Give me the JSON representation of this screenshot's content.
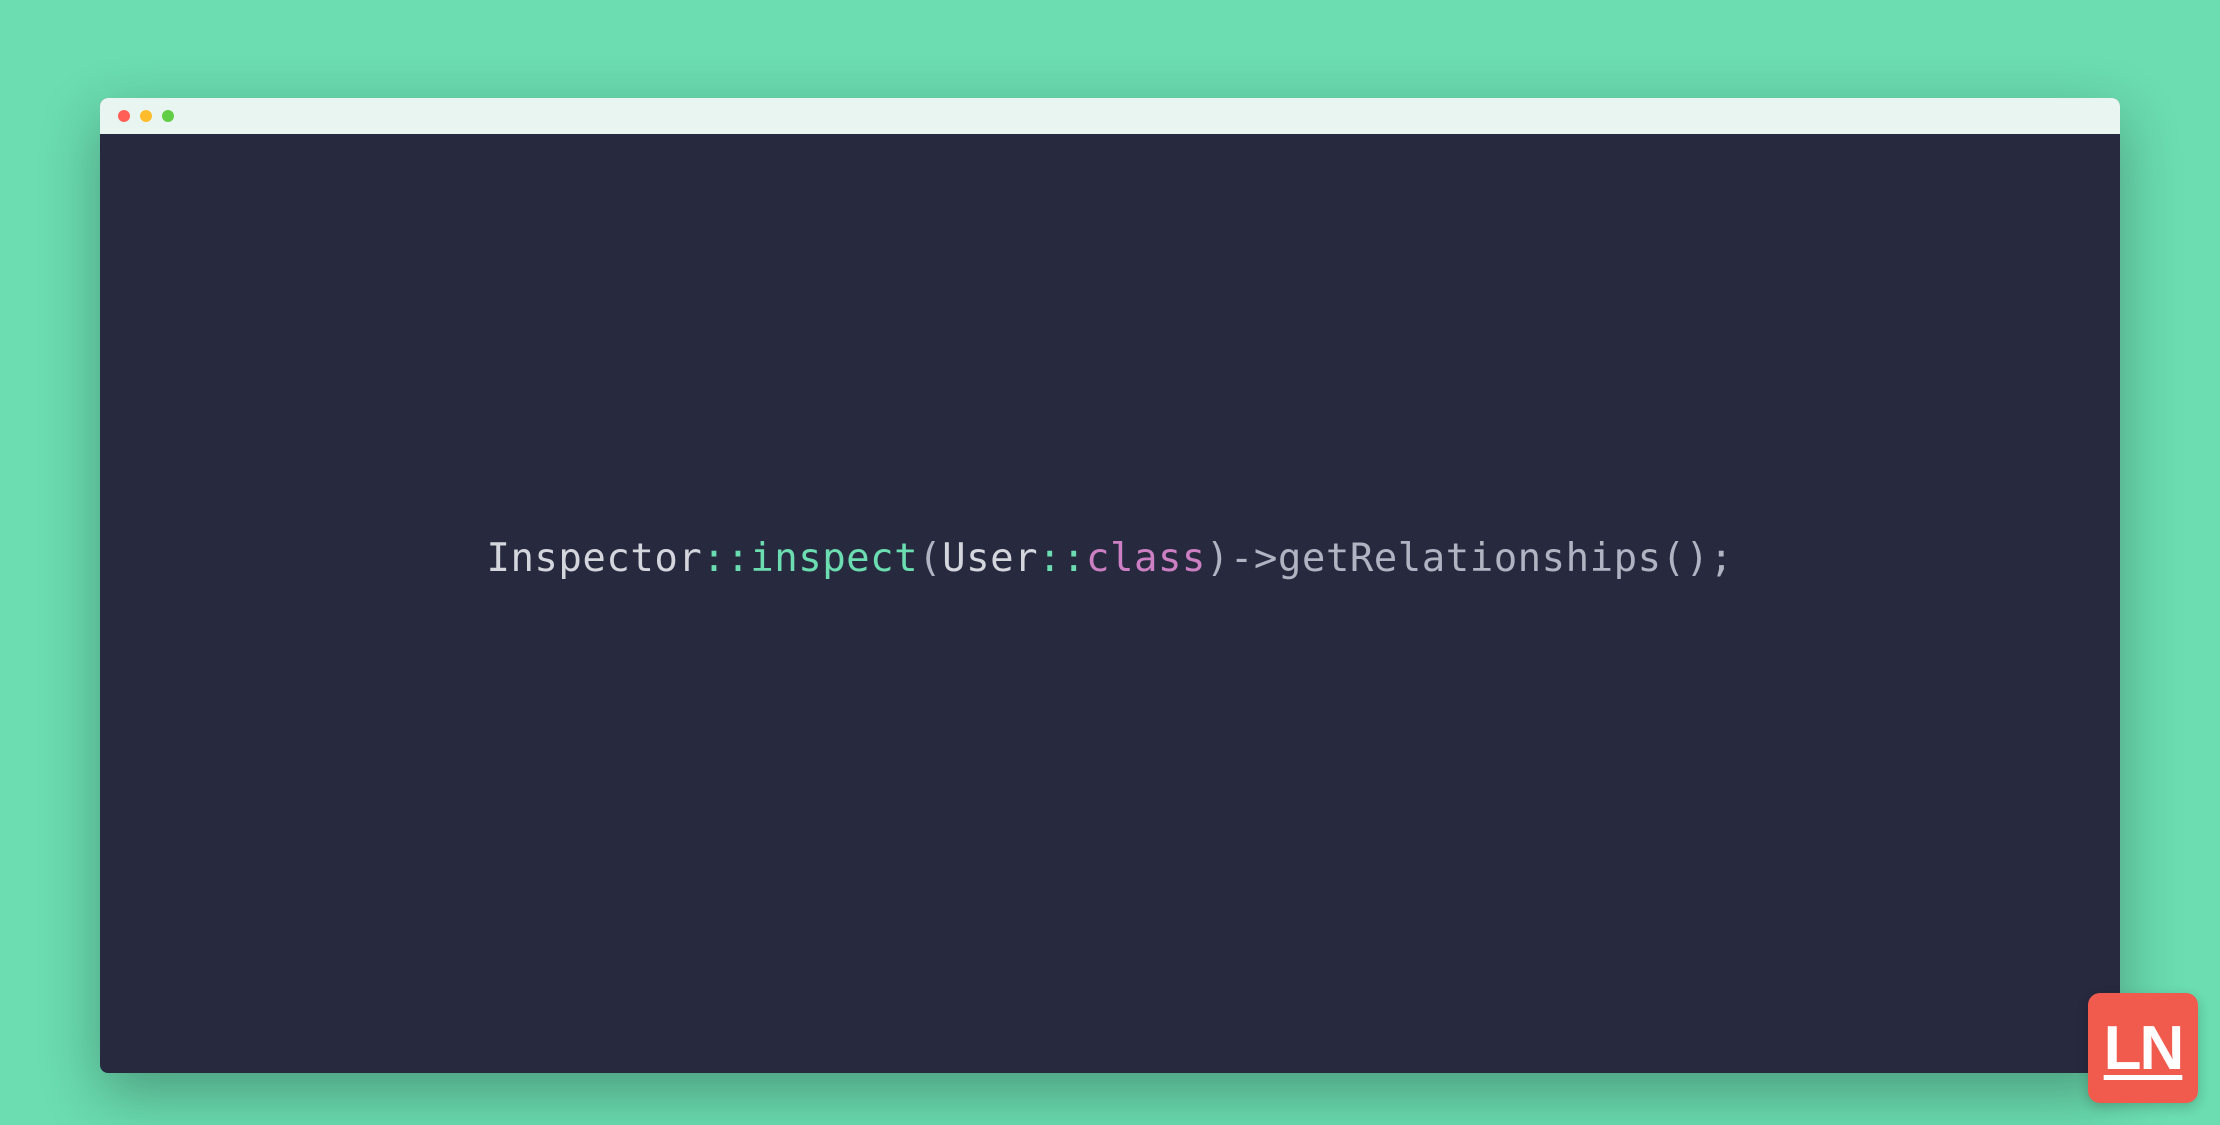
{
  "code": {
    "tokens": {
      "className": "Inspector",
      "scope1": "::",
      "methodHighlight": "inspect",
      "openParen1": "(",
      "param": "User",
      "scope2": "::",
      "keyword": "class",
      "closeParen1": ")",
      "arrow": "->",
      "method": "getRelationships",
      "openParen2": "(",
      "closeParen2": ")",
      "semicolon": ";"
    }
  },
  "logo": {
    "text": "LN"
  },
  "colors": {
    "background": "#6bddb0",
    "editorBg": "#272a3f",
    "titleBarBg": "#e8f5f0",
    "logoRed": "#f15b4e"
  }
}
